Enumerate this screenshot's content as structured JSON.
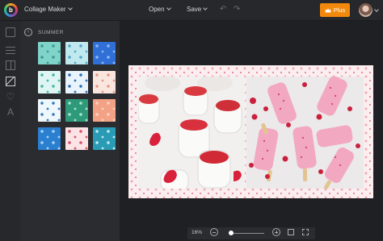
{
  "header": {
    "app_title": "Collage Maker",
    "open_label": "Open",
    "save_label": "Save",
    "plus_label": "Plus",
    "plus_color": "#f2890c"
  },
  "rail": {
    "icons": [
      "photo-icon",
      "sliders-icon",
      "layout-icon",
      "background-icon",
      "heart-icon",
      "text-icon"
    ],
    "text_icon_glyph": "A",
    "heart_icon_glyph": "♡",
    "undo_glyph": "↶",
    "redo_glyph": "↷",
    "back_glyph": "‹"
  },
  "panel": {
    "title": "SUMMER",
    "tiles": [
      {
        "bg": "#7fd3c9",
        "fg": "#3d9c92"
      },
      {
        "bg": "#bfe9ef",
        "fg": "#5aa7c8"
      },
      {
        "bg": "#2f6fd6",
        "fg": "#8fb6f2"
      },
      {
        "bg": "#dff5f3",
        "fg": "#48b6a7"
      },
      {
        "bg": "#e9f3fb",
        "fg": "#2e6fb6"
      },
      {
        "bg": "#f9e7df",
        "fg": "#e79a86"
      },
      {
        "bg": "#eef7fb",
        "fg": "#3a7bbf"
      },
      {
        "bg": "#2e9a7a",
        "fg": "#a8e3cf"
      },
      {
        "bg": "#f3a286",
        "fg": "#fbd3c3"
      },
      {
        "bg": "#2a7fd0",
        "fg": "#a9d2f7"
      },
      {
        "bg": "#fbe3e6",
        "fg": "#d9536b"
      },
      {
        "bg": "#2a9bb5",
        "fg": "#bfe9f2"
      }
    ]
  },
  "zoom": {
    "percent": "16%",
    "level": 0.06
  }
}
